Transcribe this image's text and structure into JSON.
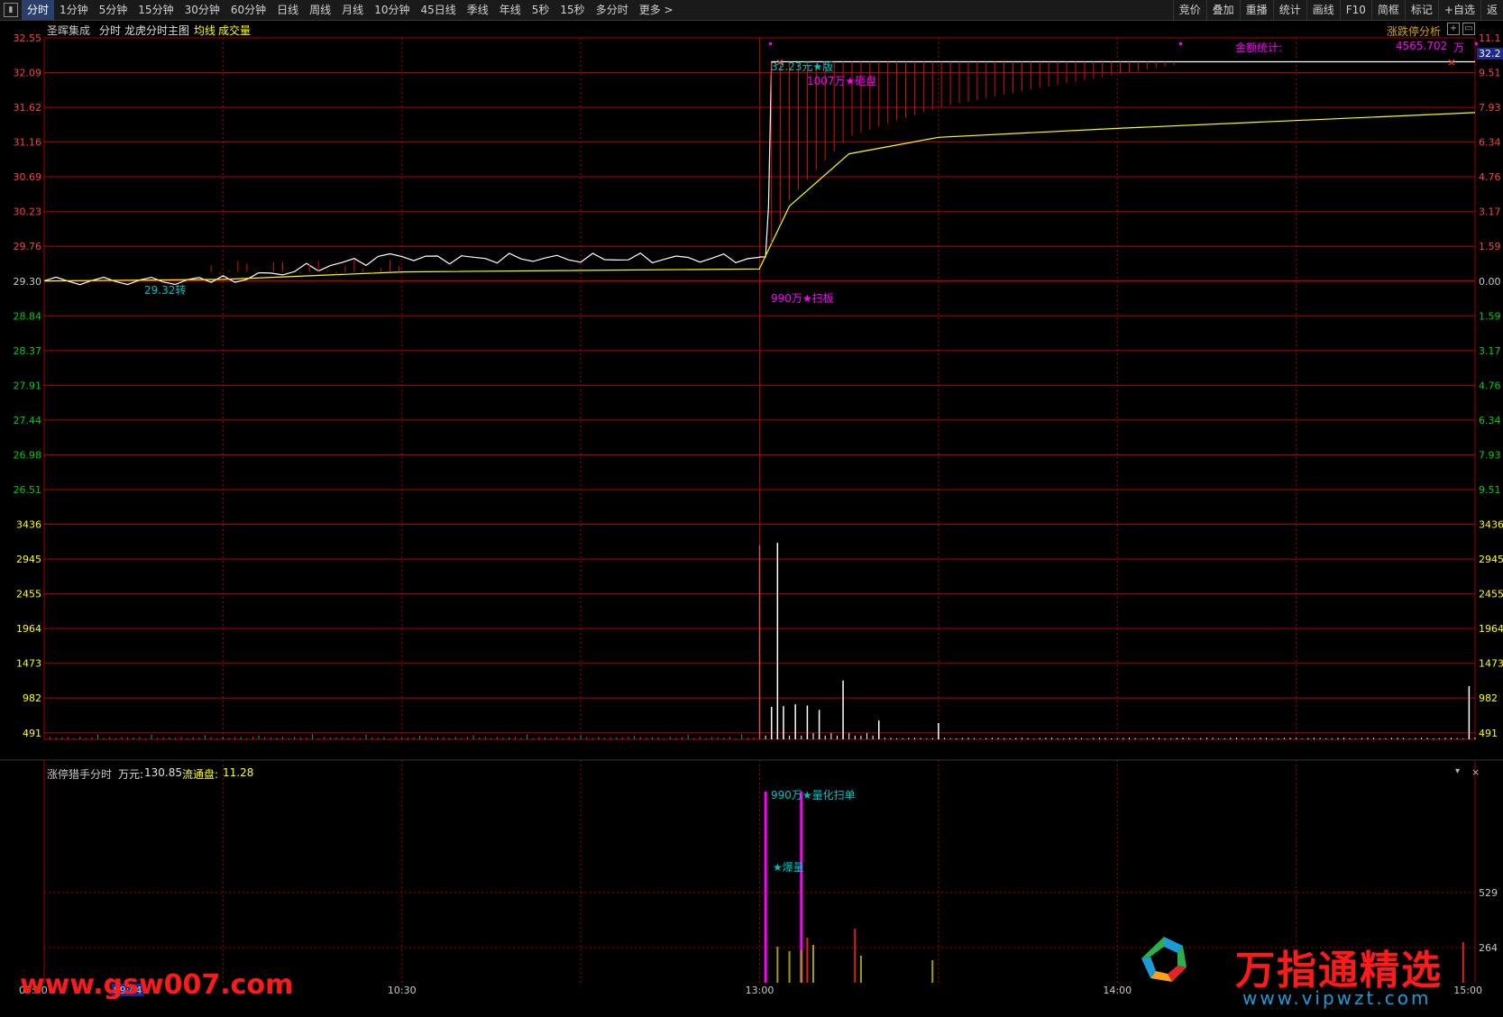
{
  "toolbar": {
    "left": [
      "分时",
      "1分钟",
      "5分钟",
      "15分钟",
      "30分钟",
      "60分钟",
      "日线",
      "周线",
      "月线",
      "10分钟",
      "45日线",
      "季线",
      "年线",
      "5秒",
      "15秒",
      "多分时",
      "更多 >"
    ],
    "right": [
      "竞价",
      "叠加",
      "重播",
      "统计",
      "画线",
      "F10",
      "简框",
      "标记",
      "+自选",
      "返"
    ]
  },
  "main_header": {
    "stock_name": "圣晖集成",
    "mode": "分时",
    "indicator": "龙虎分时主图",
    "avg_line": "均线",
    "volume": "成交量",
    "right_link": "涨跌停分析"
  },
  "price_axis": [
    "32.55",
    "32.09",
    "31.62",
    "31.16",
    "30.69",
    "30.23",
    "29.76",
    "29.30",
    "28.84",
    "28.37",
    "27.91",
    "27.44",
    "26.98",
    "26.51"
  ],
  "pct_axis": [
    "11.1",
    "9.51",
    "7.93",
    "6.34",
    "4.76",
    "3.17",
    "1.59",
    "0.00",
    "1.59",
    "3.17",
    "4.76",
    "6.34",
    "7.93",
    "9.51"
  ],
  "vol_axis": [
    "3436",
    "2945",
    "2455",
    "1964",
    "1473",
    "982",
    "491"
  ],
  "bottom_axis": [
    "529",
    "264"
  ],
  "time_axis": [
    "09:30",
    "09:44",
    "10:30",
    "13:00",
    "14:00",
    "15:00"
  ],
  "annotations": {
    "jinge_label": "金额统计:",
    "jinge_value": "4565.702",
    "jinge_unit": "万",
    "limit_price_box": "32.2",
    "limit_note": "32.23元★版",
    "zapan": "1007万★砸盘",
    "saoban": "990万★扫板",
    "zhuan": "29.32转"
  },
  "sub_header": {
    "name": "涨停猎手分时",
    "wanyuan_label": "万元:",
    "wanyuan_value": "130.85",
    "liutong_label": "流通盘:",
    "liutong_value": "11.28"
  },
  "sub_annotations": {
    "lianghua": "990万★量化扫单",
    "baoliang": "★爆量"
  },
  "watermarks": {
    "left": "www.gsw007.com",
    "right_title": "万指通精选",
    "right_url": "www.vipwzt.com"
  },
  "chart_data": {
    "type": "line",
    "prev_close": 29.3,
    "ylim": [
      26.51,
      32.55
    ],
    "series": [
      {
        "name": "分时",
        "color": "#ffffff",
        "x": [
          "09:30",
          "09:44",
          "09:55",
          "10:05",
          "10:15",
          "10:30",
          "10:45",
          "11:00",
          "11:15",
          "11:30",
          "13:00",
          "13:01",
          "13:10",
          "14:00",
          "15:00"
        ],
        "values": [
          29.3,
          29.38,
          29.33,
          29.45,
          29.66,
          29.6,
          29.55,
          29.52,
          29.5,
          29.62,
          29.62,
          32.23,
          32.23,
          32.23,
          32.23
        ]
      },
      {
        "name": "均线",
        "color": "#ffff00",
        "x": [
          "09:30",
          "10:00",
          "10:30",
          "11:30",
          "13:00",
          "13:05",
          "13:15",
          "13:30",
          "14:00",
          "15:00"
        ],
        "values": [
          29.3,
          29.32,
          29.42,
          29.46,
          29.47,
          30.3,
          31.0,
          31.22,
          31.34,
          31.55
        ]
      }
    ],
    "volume_ylim": [
      0,
      3436
    ],
    "volume_spikes": [
      {
        "time": "13:00",
        "value": 3100
      },
      {
        "time": "13:03",
        "value": 3140
      },
      {
        "time": "13:14",
        "value": 940
      },
      {
        "time": "14:59",
        "value": 850
      }
    ]
  }
}
